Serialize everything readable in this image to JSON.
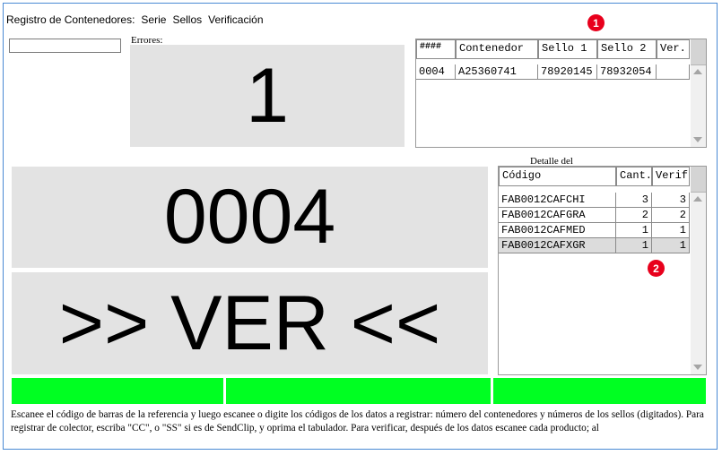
{
  "menu": {
    "items": [
      "Registro de Contenedores:",
      "Serie",
      "Sellos",
      "Verificación"
    ]
  },
  "input": {
    "value": ""
  },
  "errors": {
    "label": "Errores:",
    "value": "1"
  },
  "counter": {
    "value": "0004"
  },
  "status": {
    "text": ">> VER <<"
  },
  "containers_table": {
    "headers": [
      "####",
      "Contenedor",
      "Sello 1",
      "Sello 2",
      "Ver."
    ],
    "rows": [
      [
        "0004",
        "A25360741",
        "78920145",
        "78932054",
        ""
      ]
    ]
  },
  "detail": {
    "label": "Detalle del",
    "headers": [
      "Código",
      "Cant.",
      "Verif."
    ],
    "rows": [
      [
        "FAB0012CAFCHI",
        "3",
        "3"
      ],
      [
        "FAB0012CAFGRA",
        "2",
        "2"
      ],
      [
        "FAB0012CAFMED",
        "1",
        "1"
      ],
      [
        "FAB0012CAFXGR",
        "1",
        "1"
      ]
    ],
    "selected_row": 3
  },
  "instructions": {
    "text": "Escanee el código de barras de la referencia y luego escanee o digite los códigos de los datos a registrar: número del contenedores y números de los sellos (digitados). Para registrar de colector, escriba \"CC\", o \"SS\" si es de SendClip, y oprima el tabulador. Para verificar, después de los datos escanee cada producto; al"
  },
  "annotations": [
    "1",
    "2"
  ],
  "colors": {
    "green": "#00ff22",
    "panel": "#e3e3e3",
    "badge": "#e8001c"
  }
}
